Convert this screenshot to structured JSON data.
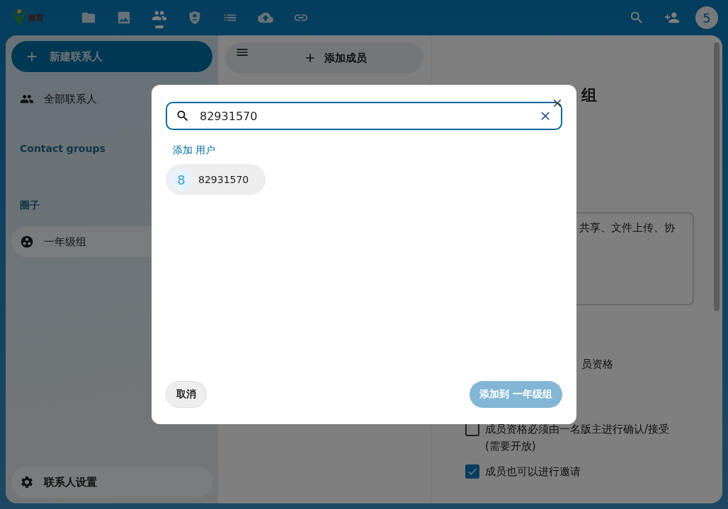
{
  "header": {
    "logo_text": "教育",
    "apps": [
      {
        "kind": "folder",
        "selected": false
      },
      {
        "kind": "photos",
        "selected": false
      },
      {
        "kind": "contacts",
        "selected": true
      },
      {
        "kind": "shield",
        "selected": false
      },
      {
        "kind": "list",
        "selected": false
      },
      {
        "kind": "upload",
        "selected": false
      },
      {
        "kind": "link",
        "selected": false
      }
    ],
    "avatar": "5"
  },
  "sidebar": {
    "new_button": "新建联系人",
    "all_contacts": {
      "label": "全部联系人",
      "selected": false
    },
    "groups_heading": "Contact groups",
    "circles_heading": "圈子",
    "circles": [
      {
        "label": "一年级组",
        "selected": true
      }
    ],
    "settings": "联系人设置"
  },
  "member_list": {
    "add_button": "添加成员"
  },
  "details": {
    "title_fragment": "组",
    "description_fragment": "共享、文件上传、协",
    "option_fragment": "员资格",
    "options": [
      {
        "label": "成员资格必须由一名版主进行确认/接受 (需要开放)",
        "checked": false
      },
      {
        "label": "成员也可以进行邀请",
        "checked": true
      }
    ]
  },
  "dialog": {
    "search_value": "82931570",
    "section_label": "添加 用户",
    "results": [
      {
        "initial": "8",
        "name": "82931570"
      }
    ],
    "cancel_button": "取消",
    "confirm_button": {
      "label": "添加到 一年级组",
      "disabled": true
    }
  }
}
